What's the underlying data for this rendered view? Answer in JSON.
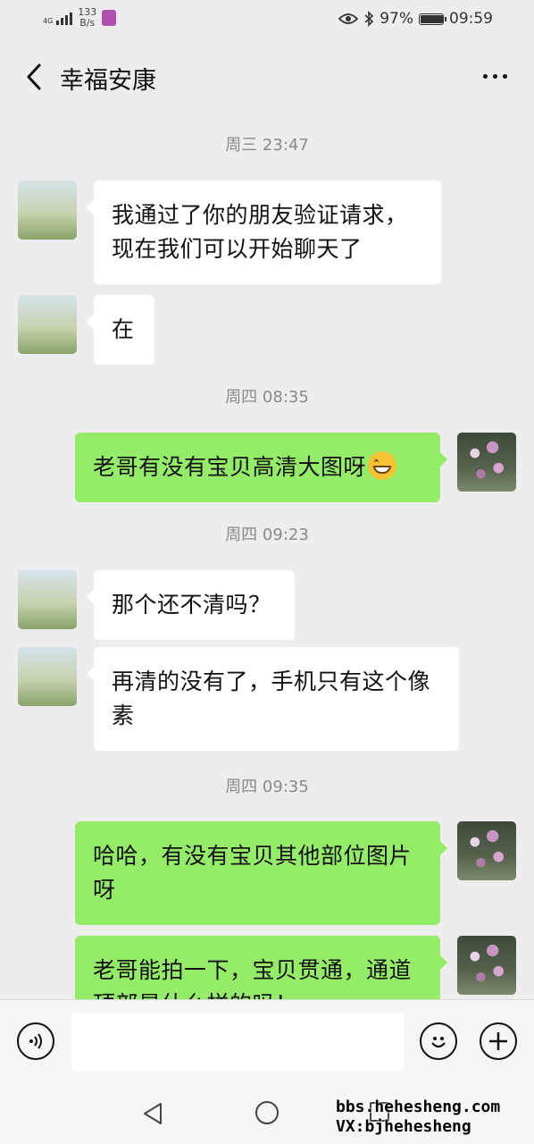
{
  "status_bar": {
    "network_type": "4G",
    "net_speed_value": "133",
    "net_speed_unit": "B/s",
    "battery_percent": "97%",
    "battery_level": 0.97,
    "time": "09:59"
  },
  "header": {
    "title": "幸福安康"
  },
  "chat": {
    "messages": [
      {
        "kind": "time",
        "text": "周三 23:47"
      },
      {
        "kind": "msg",
        "side": "in",
        "text": "我通过了你的朋友验证请求，现在我们可以开始聊天了"
      },
      {
        "kind": "msg",
        "side": "in",
        "text": "在"
      },
      {
        "kind": "time",
        "text": "周四 08:35"
      },
      {
        "kind": "msg",
        "side": "out",
        "text": "老哥有没有宝贝高清大图呀",
        "emoji": "grinning-face"
      },
      {
        "kind": "time",
        "text": "周四 09:23"
      },
      {
        "kind": "msg",
        "side": "in",
        "text": "那个还不清吗？"
      },
      {
        "kind": "msg",
        "side": "in",
        "text": "再清的没有了，手机只有这个像素"
      },
      {
        "kind": "time",
        "text": "周四 09:35"
      },
      {
        "kind": "msg",
        "side": "out",
        "text": "哈哈，有没有宝贝其他部位图片呀"
      },
      {
        "kind": "msg",
        "side": "out",
        "text": "老哥能拍一下，宝贝贯通，通道顶部是什么样的吗！"
      }
    ]
  },
  "icons": {
    "back": "chevron-left-icon",
    "more": "more-dots-icon",
    "voice": "voice-icon",
    "emoji": "emoji-icon",
    "add": "plus-icon"
  },
  "colors": {
    "background": "#ededed",
    "bubble_in": "#ffffff",
    "bubble_out": "#95ec69"
  },
  "watermark": {
    "line1": "bbs.hehesheng.com",
    "line2": "VX:bjhehesheng"
  }
}
